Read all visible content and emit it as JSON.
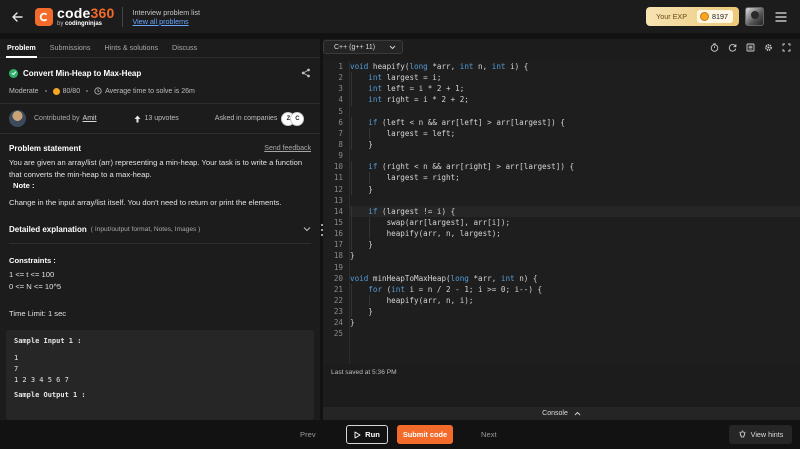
{
  "header": {
    "logo_brand": "code",
    "logo_number": "360",
    "logo_by": "by",
    "logo_company": "codingninjas",
    "crumb_top": "Interview problem list",
    "crumb_link": "View all problems",
    "exp_label": "Your EXP",
    "exp_value": "8197",
    "icons": [
      "back-arrow-icon",
      "hamburger-menu-icon"
    ]
  },
  "tabs": [
    {
      "label": "Problem",
      "active": true
    },
    {
      "label": "Submissions",
      "active": false
    },
    {
      "label": "Hints & solutions",
      "active": false
    },
    {
      "label": "Discuss",
      "active": false
    }
  ],
  "problem": {
    "title": "Convert Min-Heap to Max-Heap",
    "difficulty": "Moderate",
    "score": "80/80",
    "avg_time": "Average time to solve is 26m",
    "contributed_by_label": "Contributed by",
    "contributor": "Amit",
    "upvotes": "13 upvotes",
    "asked_in_label": "Asked in companies",
    "companies": [
      "Z",
      "C"
    ],
    "statement_heading": "Problem statement",
    "send_feedback": "Send feedback",
    "statement": "You are given an array/list (arr) representing a min-heap. Your task is to write a function that converts the min-heap to a max-heap.",
    "note_label": "Note :",
    "note_text": "Change in the input array/list itself. You don't need to return or print the elements.",
    "detailed_heading": "Detailed explanation",
    "detailed_sub": "( Input/output format, Notes, Images )",
    "constraints_heading": "Constraints :",
    "constraints": [
      "1 <= t <= 100",
      "0 <= N <= 10^5"
    ],
    "time_limit": "Time Limit: 1 sec",
    "sample_input_heading": "Sample Input 1 :",
    "sample_input_lines": [
      "1",
      "7",
      "1 2 3 4 5 6 7"
    ],
    "sample_output_heading": "Sample Output 1 :"
  },
  "editor": {
    "language": "C++ (g++ 11)",
    "tool_icons": [
      "timer-icon",
      "refresh-icon",
      "list-icon",
      "settings-icon",
      "fullscreen-icon"
    ],
    "current_line": 14,
    "last_saved": "Last saved at 5:36 PM",
    "console_label": "Console",
    "code_lines": [
      "void heapify(long *arr, int n, int i) {",
      "    int largest = i;",
      "    int left = i * 2 + 1;",
      "    int right = i * 2 + 2;",
      "",
      "    if (left < n && arr[left] > arr[largest]) {",
      "        largest = left;",
      "    }",
      "",
      "    if (right < n && arr[right] > arr[largest]) {",
      "        largest = right;",
      "    }",
      "",
      "    if (largest != i) {",
      "        swap(arr[largest], arr[i]);",
      "        heapify(arr, n, largest);",
      "    }",
      "}",
      "",
      "void minHeapToMaxHeap(long *arr, int n) {",
      "    for (int i = n / 2 - 1; i >= 0; i--) {",
      "        heapify(arr, n, i);",
      "    }",
      "}",
      ""
    ]
  },
  "footer": {
    "prev": "Prev",
    "run": "Run",
    "submit": "Submit code",
    "next": "Next",
    "hints": "View hints"
  },
  "colors": {
    "accent": "#f36b2a",
    "success": "#2fb36c",
    "keyword": "#569cd6",
    "link": "#6aa6ff"
  }
}
